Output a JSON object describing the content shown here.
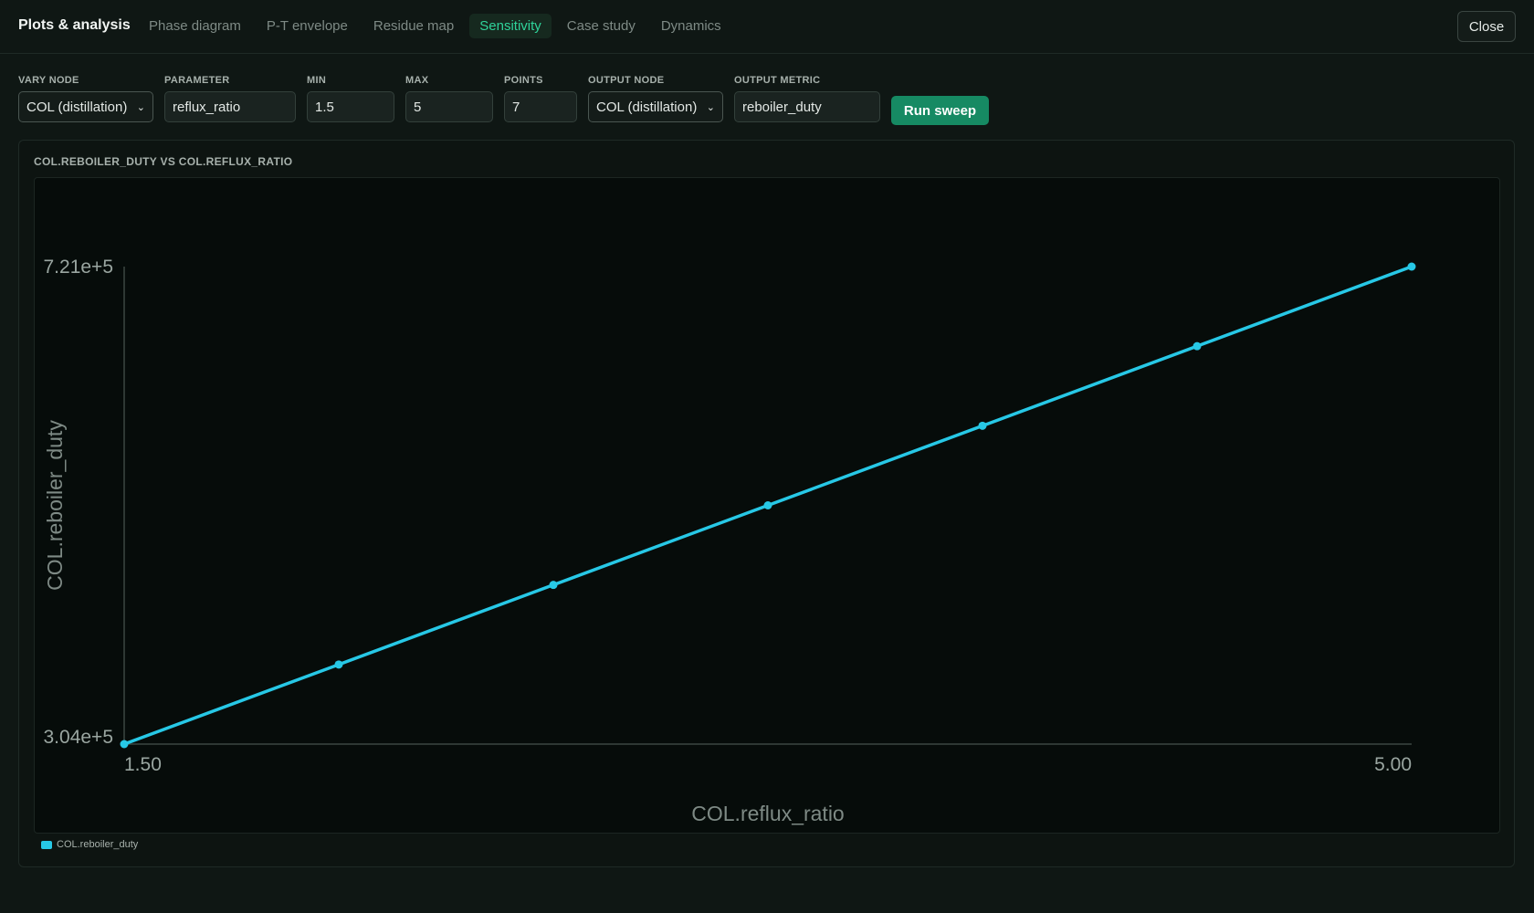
{
  "header": {
    "title": "Plots & analysis",
    "tabs": [
      {
        "label": "Phase diagram",
        "active": false
      },
      {
        "label": "P-T envelope",
        "active": false
      },
      {
        "label": "Residue map",
        "active": false
      },
      {
        "label": "Sensitivity",
        "active": true
      },
      {
        "label": "Case study",
        "active": false
      },
      {
        "label": "Dynamics",
        "active": false
      }
    ],
    "close_label": "Close"
  },
  "controls": {
    "vary_node": {
      "label": "VARY NODE",
      "value": "COL (distillation)"
    },
    "parameter": {
      "label": "PARAMETER",
      "value": "reflux_ratio"
    },
    "min": {
      "label": "MIN",
      "value": "1.5"
    },
    "max": {
      "label": "MAX",
      "value": "5"
    },
    "points": {
      "label": "POINTS",
      "value": "7"
    },
    "output_node": {
      "label": "OUTPUT NODE",
      "value": "COL (distillation)"
    },
    "output_metric": {
      "label": "OUTPUT METRIC",
      "value": "reboiler_duty"
    },
    "run_label": "Run sweep"
  },
  "chart_data": {
    "type": "line",
    "title": "COL.REBOILER_DUTY VS COL.REFLUX_RATIO",
    "xlabel": "COL.reflux_ratio",
    "ylabel": "COL.reboiler_duty",
    "x_tick_labels": [
      "1.50",
      "5.00"
    ],
    "y_tick_labels": [
      "3.04e+5",
      "7.21e+5"
    ],
    "xlim": [
      1.5,
      5.0
    ],
    "ylim": [
      304000,
      721000
    ],
    "grid": false,
    "legend_position": "bottom-left",
    "series": [
      {
        "name": "COL.reboiler_duty",
        "color": "#27c8e6",
        "x": [
          1.5,
          2.0833,
          2.6667,
          3.25,
          3.8333,
          4.4167,
          5.0
        ],
        "y": [
          304000,
          373500,
          443000,
          512500,
          582000,
          651500,
          721000
        ]
      }
    ]
  }
}
